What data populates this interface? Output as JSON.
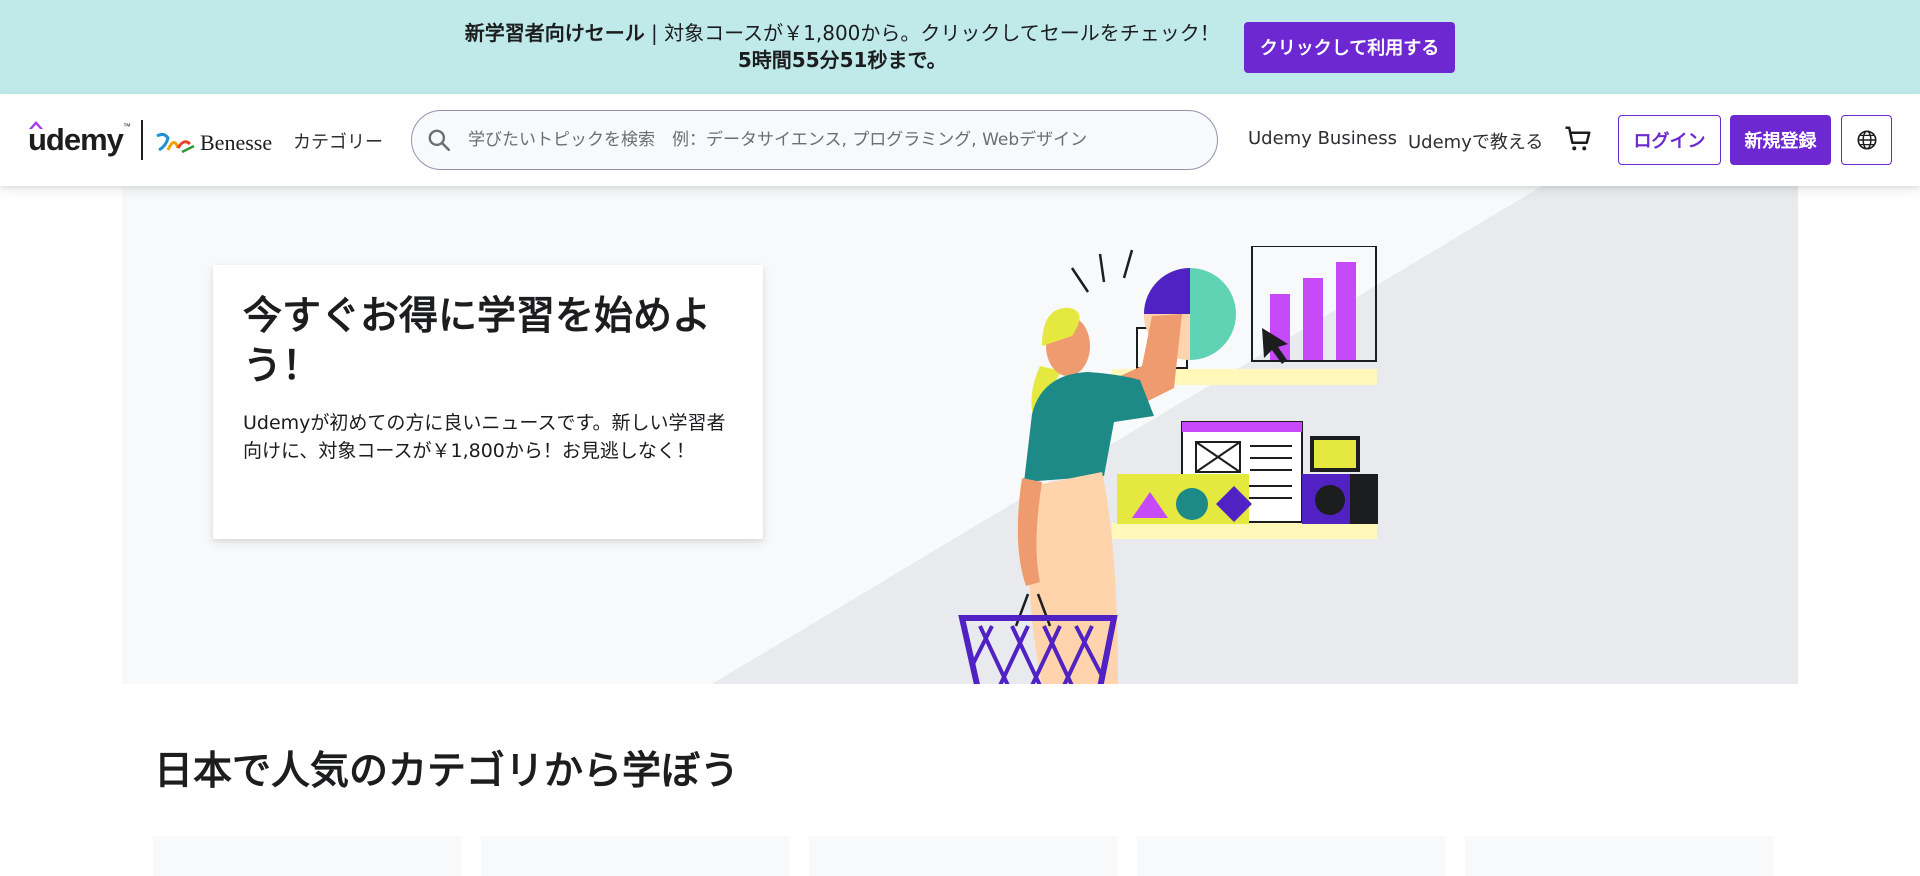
{
  "promo": {
    "headline": "新学習者向けセール",
    "separator": " | ",
    "detail": "対象コースが￥1,800から。クリックしてセールをチェック！",
    "countdown": "5時間55分51秒まで。",
    "cta_label": "クリックして利用する"
  },
  "header": {
    "logo_text": "udemy",
    "logo_tm": "™",
    "partner_logo_text": "Benesse",
    "category_label": "カテゴリー",
    "search_placeholder": "学びたいトピックを検索　例：データサイエンス, プログラミング, Webデザイン",
    "nav": {
      "business": "Udemy Business",
      "teach": "Udemyで教える"
    },
    "login_label": "ログイン",
    "signup_label": "新規登録",
    "icons": {
      "search": "search-icon",
      "cart": "cart-icon",
      "language": "globe-icon"
    }
  },
  "hero": {
    "title": "今すぐお得に学習を始めよう！",
    "subtitle": "Udemyが初めての方に良いニュースです。新しい学習者向けに、対象コースが￥1,800から！お見逃しなく！"
  },
  "categories": {
    "title": "日本で人気のカテゴリから学ぼう",
    "tile_count": 5
  },
  "colors": {
    "banner_bg": "#c0eaea",
    "brand_purple": "#6d28d2",
    "hero_bg": "#f7f9fa"
  }
}
